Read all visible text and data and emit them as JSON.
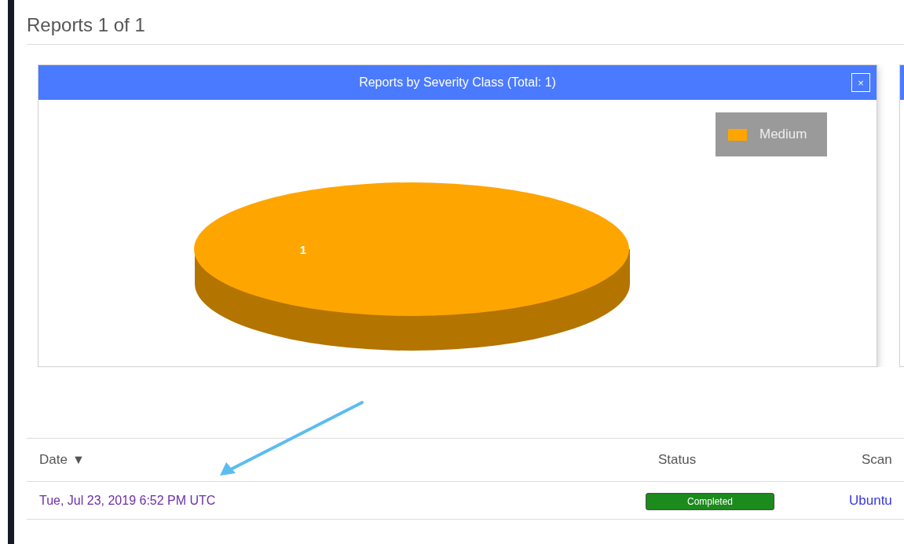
{
  "page": {
    "title": "Reports 1 of 1"
  },
  "chart_card": {
    "chart_data": {
      "type": "pie",
      "title": "Reports by Severity Class (Total: 1)",
      "categories": [
        "Medium"
      ],
      "series": [
        {
          "color": "#ffa500",
          "values": [
            1
          ]
        }
      ],
      "data_labels": true
    },
    "close": "×"
  },
  "table": {
    "columns": [
      {
        "label": "Date",
        "sort": "▼"
      },
      {
        "label": "Status"
      },
      {
        "label": "Scan"
      }
    ],
    "rows": [
      {
        "date": "Tue, Jul 23, 2019 6:52 PM UTC",
        "status": "Completed",
        "scan": "Ubuntu"
      }
    ]
  }
}
